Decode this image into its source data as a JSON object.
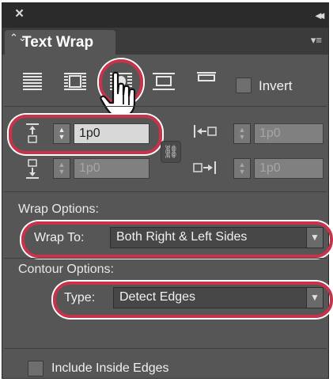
{
  "panel": {
    "close_glyph": "×",
    "collapse_glyph": "◂◂",
    "tab_label": "Text Wrap",
    "tab_arrows": "⌃⌄",
    "menu_glyph": "▾≡"
  },
  "wrap_buttons": [
    {
      "name": "no-text-wrap",
      "icon": "no-wrap-icon"
    },
    {
      "name": "wrap-around-bounding-box",
      "icon": "bounding-box-wrap-icon"
    },
    {
      "name": "wrap-around-object-shape",
      "icon": "object-shape-wrap-icon",
      "selected": true
    },
    {
      "name": "jump-object",
      "icon": "jump-object-icon"
    },
    {
      "name": "jump-to-next-column",
      "icon": "jump-next-column-icon"
    }
  ],
  "invert": {
    "label": "Invert",
    "checked": false
  },
  "offsets": {
    "top": {
      "value": "1p0"
    },
    "bottom": {
      "value": "1p0"
    },
    "left": {
      "value": "1p0"
    },
    "right": {
      "value": "1p0"
    }
  },
  "wrap_options": {
    "heading": "Wrap Options:",
    "wrap_to_label": "Wrap To:",
    "wrap_to_value": "Both Right & Left Sides"
  },
  "contour_options": {
    "heading": "Contour Options:",
    "type_label": "Type:",
    "type_value": "Detect Edges"
  },
  "include_inside_edges": {
    "label": "Include Inside Edges",
    "checked": false
  },
  "highlight_color": "#c8324a"
}
